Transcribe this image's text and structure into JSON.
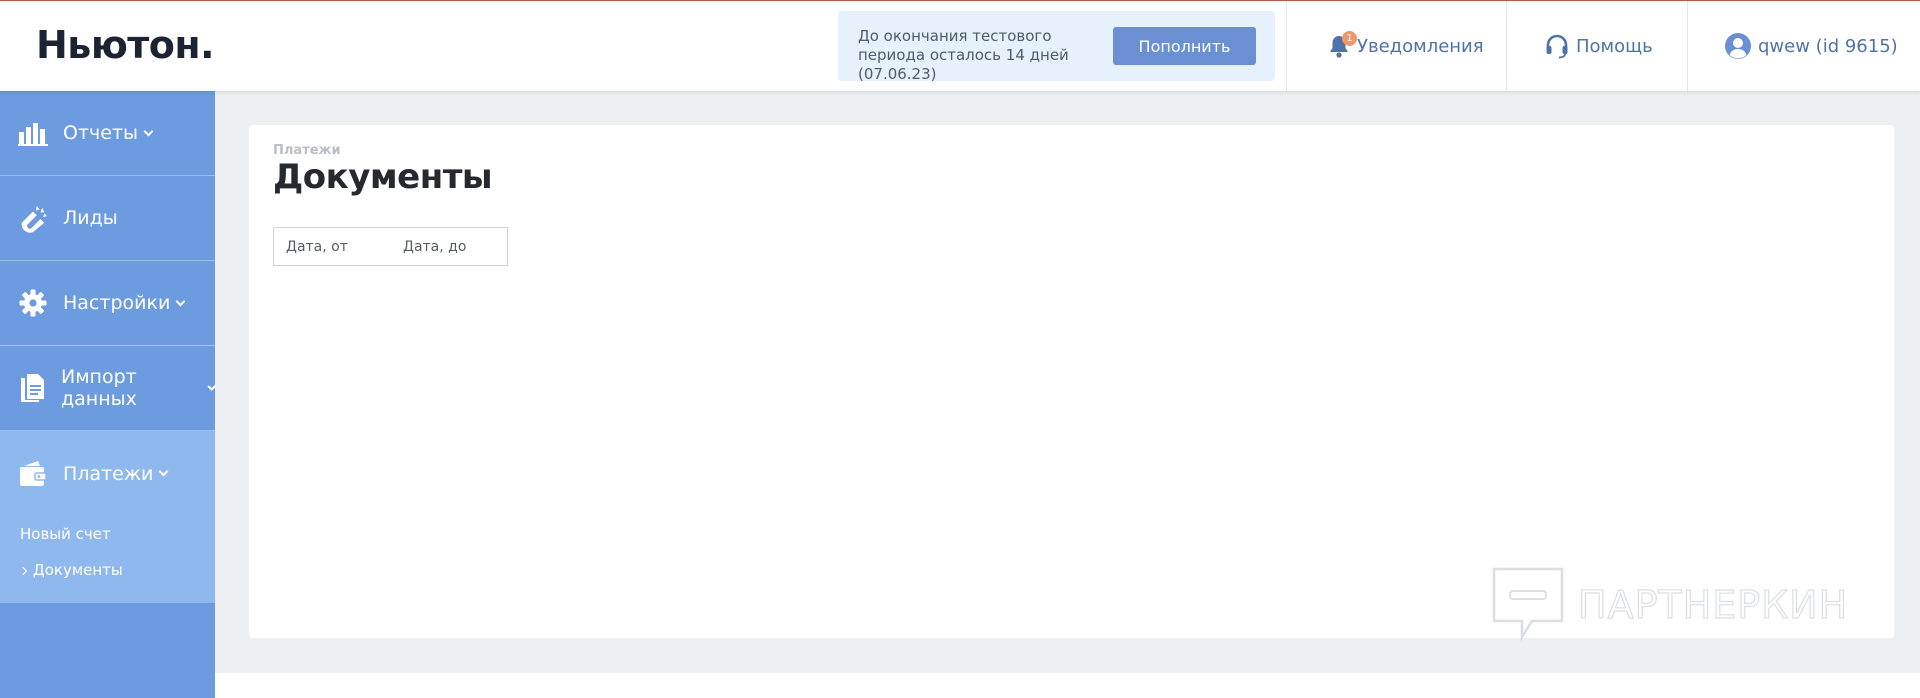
{
  "app": {
    "logo": "Ньютон."
  },
  "trial": {
    "message": "До окончания тестового периода осталось 14 дней (07.06.23)",
    "button_label": "Пополнить"
  },
  "header": {
    "notifications_label": "Уведомления",
    "notifications_count": "1",
    "help_label": "Помощь",
    "user_label": "qwew (id 9615)"
  },
  "sidebar": {
    "items": [
      {
        "label": "Отчеты",
        "icon": "bar-chart-icon",
        "has_submenu": true
      },
      {
        "label": "Лиды",
        "icon": "magnet-icon",
        "has_submenu": false
      },
      {
        "label": "Настройки",
        "icon": "gear-icon",
        "has_submenu": true
      },
      {
        "label": "Импорт данных",
        "icon": "document-icon",
        "has_submenu": true
      },
      {
        "label": "Платежи",
        "icon": "wallet-icon",
        "has_submenu": true,
        "active": true
      }
    ],
    "payments_submenu": [
      {
        "label": "Новый счет"
      },
      {
        "label": "Документы",
        "active": true
      }
    ]
  },
  "page": {
    "breadcrumb": "Платежи",
    "title": "Документы",
    "date_from_placeholder": "Дата, от",
    "date_to_placeholder": "Дата, до"
  },
  "watermark": {
    "text": "ПАРТНЕРКИН"
  },
  "colors": {
    "sidebar": "#6c9bdf",
    "sidebar_active": "#8fb8ee",
    "accent_button": "#6a90d3",
    "link": "#4f73a8",
    "badge": "#f0976a"
  }
}
